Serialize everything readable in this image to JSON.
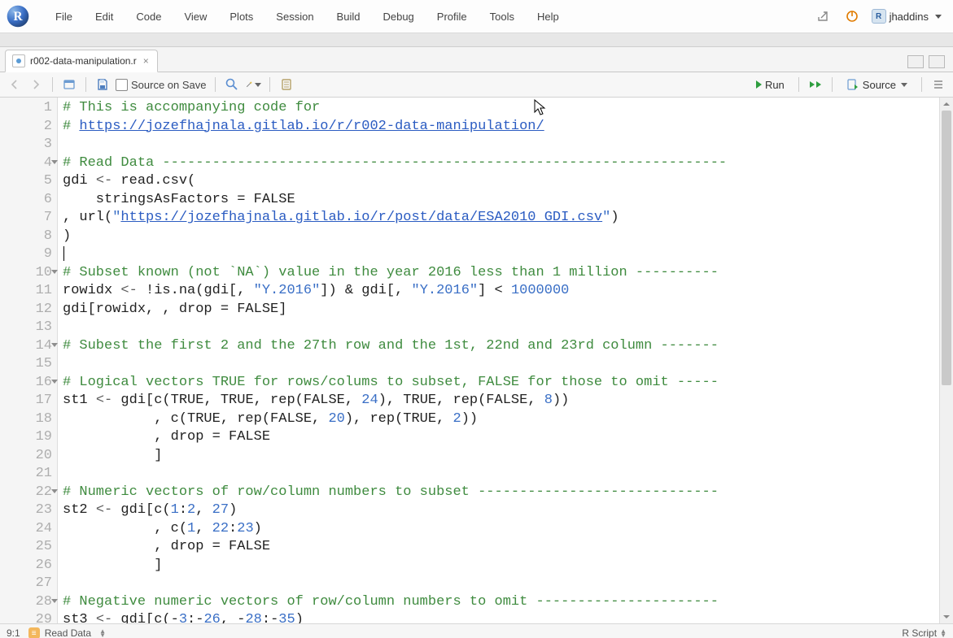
{
  "app": {
    "menus": [
      "File",
      "Edit",
      "Code",
      "View",
      "Plots",
      "Session",
      "Build",
      "Debug",
      "Profile",
      "Tools",
      "Help"
    ],
    "user": "jhaddins"
  },
  "tab": {
    "filename": "r002-data-manipulation.r"
  },
  "toolbar": {
    "source_on_save": "Source on Save",
    "run_label": "Run",
    "source_label": "Source"
  },
  "editor": {
    "line_numbers": [
      "1",
      "2",
      "3",
      "4",
      "5",
      "6",
      "7",
      "8",
      "9",
      "10",
      "11",
      "12",
      "13",
      "14",
      "15",
      "16",
      "17",
      "18",
      "19",
      "20",
      "21",
      "22",
      "23",
      "24",
      "25",
      "26",
      "27",
      "28",
      "29"
    ],
    "fold_lines": [
      4,
      10,
      14,
      16,
      22,
      28
    ],
    "lines": [
      [
        {
          "cls": "cm-comment",
          "txt": "# This is accompanying code for"
        }
      ],
      [
        {
          "cls": "cm-comment",
          "txt": "# "
        },
        {
          "cls": "cm-link",
          "txt": "https://jozefhajnala.gitlab.io/r/r002-data-manipulation/"
        }
      ],
      [],
      [
        {
          "cls": "cm-comment",
          "txt": "# Read Data --------------------------------------------------------------------"
        }
      ],
      [
        {
          "cls": "cm-id",
          "txt": "gdi "
        },
        {
          "cls": "cm-op",
          "txt": "<- "
        },
        {
          "cls": "cm-id",
          "txt": "read.csv("
        }
      ],
      [
        {
          "cls": "",
          "txt": "    stringsAsFactors = FALSE"
        }
      ],
      [
        {
          "cls": "",
          "txt": ", url("
        },
        {
          "cls": "cm-str",
          "txt": "\""
        },
        {
          "cls": "cm-link",
          "txt": "https://jozefhajnala.gitlab.io/r/post/data/ESA2010_GDI.csv"
        },
        {
          "cls": "cm-str",
          "txt": "\""
        },
        {
          "cls": "",
          "txt": ")"
        }
      ],
      [
        {
          "cls": "",
          "txt": ")"
        }
      ],
      [
        {
          "cls": "",
          "txt": ""
        },
        {
          "cursor": true
        }
      ],
      [
        {
          "cls": "cm-comment",
          "txt": "# Subset known (not `NA`) value in the year 2016 less than 1 million ----------"
        }
      ],
      [
        {
          "cls": "",
          "txt": "rowidx "
        },
        {
          "cls": "cm-op",
          "txt": "<- "
        },
        {
          "cls": "",
          "txt": "!is.na(gdi[, "
        },
        {
          "cls": "cm-str",
          "txt": "\"Y.2016\""
        },
        {
          "cls": "",
          "txt": "]) & gdi[, "
        },
        {
          "cls": "cm-str",
          "txt": "\"Y.2016\""
        },
        {
          "cls": "",
          "txt": "] < "
        },
        {
          "cls": "cm-num",
          "txt": "1000000"
        }
      ],
      [
        {
          "cls": "",
          "txt": "gdi[rowidx, , drop = FALSE]"
        }
      ],
      [],
      [
        {
          "cls": "cm-comment",
          "txt": "# Subest the first 2 and the 27th row and the 1st, 22nd and 23rd column -------"
        }
      ],
      [],
      [
        {
          "cls": "cm-comment",
          "txt": "# Logical vectors TRUE for rows/colums to subset, FALSE for those to omit -----"
        }
      ],
      [
        {
          "cls": "",
          "txt": "st1 "
        },
        {
          "cls": "cm-op",
          "txt": "<- "
        },
        {
          "cls": "",
          "txt": "gdi[c(TRUE, TRUE, rep(FALSE, "
        },
        {
          "cls": "cm-num",
          "txt": "24"
        },
        {
          "cls": "",
          "txt": "), TRUE, rep(FALSE, "
        },
        {
          "cls": "cm-num",
          "txt": "8"
        },
        {
          "cls": "",
          "txt": "))"
        }
      ],
      [
        {
          "cls": "",
          "txt": "           , c(TRUE, rep(FALSE, "
        },
        {
          "cls": "cm-num",
          "txt": "20"
        },
        {
          "cls": "",
          "txt": "), rep(TRUE, "
        },
        {
          "cls": "cm-num",
          "txt": "2"
        },
        {
          "cls": "",
          "txt": "))"
        }
      ],
      [
        {
          "cls": "",
          "txt": "           , drop = FALSE"
        }
      ],
      [
        {
          "cls": "",
          "txt": "           ]"
        }
      ],
      [],
      [
        {
          "cls": "cm-comment",
          "txt": "# Numeric vectors of row/column numbers to subset -----------------------------"
        }
      ],
      [
        {
          "cls": "",
          "txt": "st2 "
        },
        {
          "cls": "cm-op",
          "txt": "<- "
        },
        {
          "cls": "",
          "txt": "gdi[c("
        },
        {
          "cls": "cm-num",
          "txt": "1"
        },
        {
          "cls": "",
          "txt": ":"
        },
        {
          "cls": "cm-num",
          "txt": "2"
        },
        {
          "cls": "",
          "txt": ", "
        },
        {
          "cls": "cm-num",
          "txt": "27"
        },
        {
          "cls": "",
          "txt": ")"
        }
      ],
      [
        {
          "cls": "",
          "txt": "           , c("
        },
        {
          "cls": "cm-num",
          "txt": "1"
        },
        {
          "cls": "",
          "txt": ", "
        },
        {
          "cls": "cm-num",
          "txt": "22"
        },
        {
          "cls": "",
          "txt": ":"
        },
        {
          "cls": "cm-num",
          "txt": "23"
        },
        {
          "cls": "",
          "txt": ")"
        }
      ],
      [
        {
          "cls": "",
          "txt": "           , drop = FALSE"
        }
      ],
      [
        {
          "cls": "",
          "txt": "           ]"
        }
      ],
      [],
      [
        {
          "cls": "cm-comment",
          "txt": "# Negative numeric vectors of row/column numbers to omit ----------------------"
        }
      ],
      [
        {
          "cls": "",
          "txt": "st3 "
        },
        {
          "cls": "cm-op",
          "txt": "<- "
        },
        {
          "cls": "",
          "txt": "gdi[c(-"
        },
        {
          "cls": "cm-num",
          "txt": "3"
        },
        {
          "cls": "",
          "txt": ":-"
        },
        {
          "cls": "cm-num",
          "txt": "26"
        },
        {
          "cls": "",
          "txt": ", -"
        },
        {
          "cls": "cm-num",
          "txt": "28"
        },
        {
          "cls": "",
          "txt": ":-"
        },
        {
          "cls": "cm-num",
          "txt": "35"
        },
        {
          "cls": "",
          "txt": ")"
        }
      ]
    ]
  },
  "statusbar": {
    "pos": "9:1",
    "section": "Read Data",
    "lang": "R Script"
  }
}
